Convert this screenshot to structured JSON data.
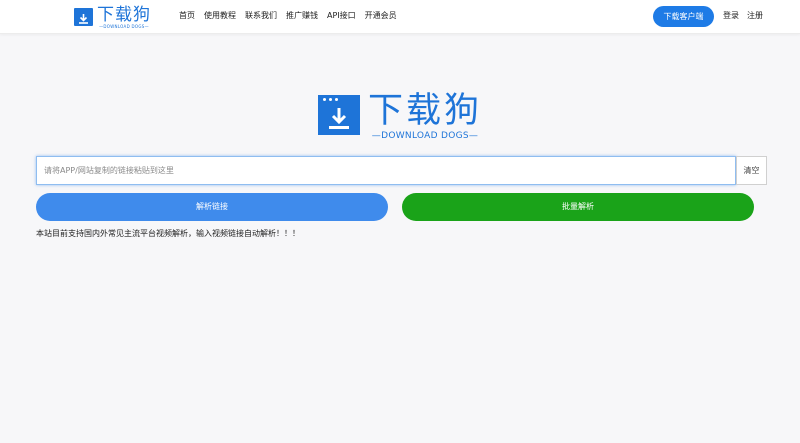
{
  "brand": {
    "name_cn": "下载狗",
    "name_en": "—DOWNLOAD DOGS—",
    "color": "#1e74d8"
  },
  "nav": {
    "items": [
      {
        "label": "首页"
      },
      {
        "label": "使用教程"
      },
      {
        "label": "联系我们"
      },
      {
        "label": "推广赚钱"
      },
      {
        "label": "API接口"
      },
      {
        "label": "开通会员"
      }
    ]
  },
  "header_actions": {
    "download_client": "下载客户端",
    "login": "登录",
    "register": "注册"
  },
  "search": {
    "value": "",
    "placeholder": "请将APP/网站复制的链接粘贴到这里",
    "clear_label": "清空"
  },
  "actions": {
    "parse_label": "解析链接",
    "batch_label": "批量解析",
    "parse_color": "#3f8bec",
    "batch_color": "#1aa319"
  },
  "notice": "本站目前支持国内外常见主流平台视频解析，输入视频链接自动解析！！！"
}
